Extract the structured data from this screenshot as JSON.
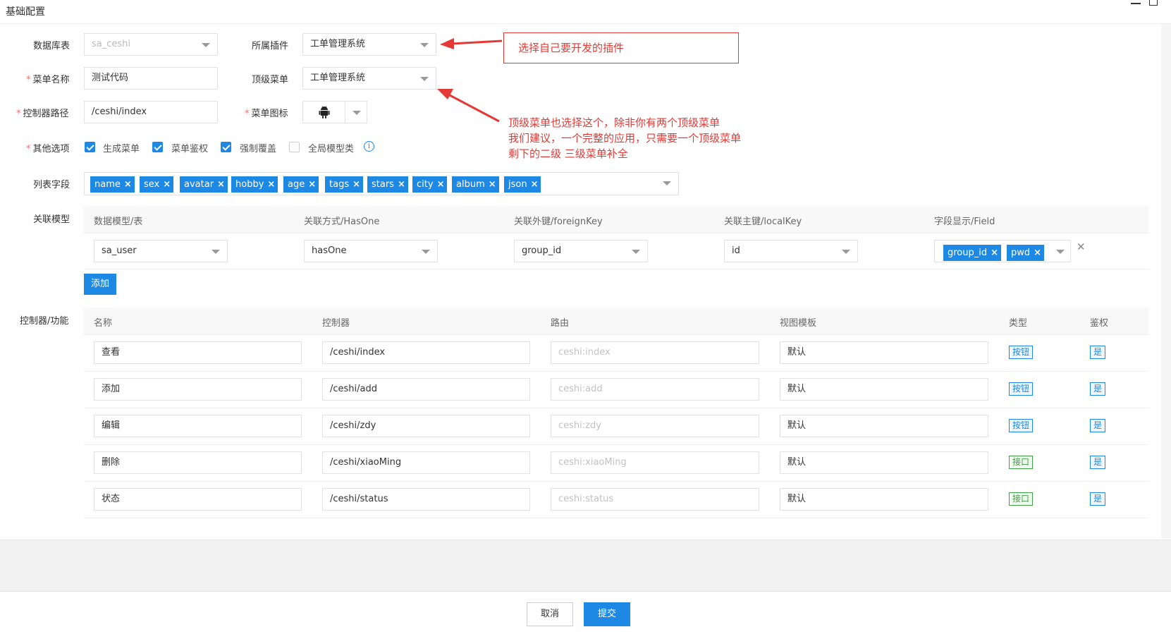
{
  "window": {
    "title": "基础配置"
  },
  "form": {
    "db_table": {
      "label": "数据库表",
      "value": "sa_ceshi"
    },
    "plugin": {
      "label": "所属插件",
      "value": "工单管理系统"
    },
    "menu_name": {
      "label": "菜单名称",
      "value": "测试代码"
    },
    "top_menu": {
      "label": "顶级菜单",
      "value": "工单管理系统"
    },
    "controller_path": {
      "label": "控制器路径",
      "value": "/ceshi/index"
    },
    "menu_icon": {
      "label": "菜单图标",
      "icon": "android-icon"
    },
    "options": {
      "label": "其他选项",
      "items": [
        {
          "label": "生成菜单",
          "checked": true
        },
        {
          "label": "菜单鉴权",
          "checked": true
        },
        {
          "label": "强制覆盖",
          "checked": true
        },
        {
          "label": "全局模型类",
          "checked": false
        }
      ],
      "info_glyph": "i"
    },
    "list_fields": {
      "label": "列表字段",
      "tags": [
        "name",
        "sex",
        "avatar",
        "hobby",
        "age",
        "tags",
        "stars",
        "city",
        "album",
        "json"
      ],
      "remove_glyph": "×"
    },
    "relations": {
      "label": "关联模型",
      "headers": [
        "数据模型/表",
        "关联方式/HasOne",
        "关联外键/foreignKey",
        "关联主键/localKey",
        "字段显示/Field"
      ],
      "row": {
        "model": "sa_user",
        "method": "hasOne",
        "foreign_key": "group_id",
        "local_key": "id",
        "fields": [
          "group_id",
          "pwd"
        ]
      },
      "remove_glyph": "✕",
      "add_label": "添加"
    },
    "functions": {
      "label": "控制器/功能",
      "headers": [
        "名称",
        "控制器",
        "路由",
        "视图模板",
        "类型",
        "鉴权"
      ],
      "rows": [
        {
          "name": "查看",
          "controller": "/ceshi/index",
          "route_placeholder": "ceshi:index",
          "template": "默认",
          "type": "按钮",
          "type_color": "blue",
          "auth": "是"
        },
        {
          "name": "添加",
          "controller": "/ceshi/add",
          "route_placeholder": "ceshi:add",
          "template": "默认",
          "type": "按钮",
          "type_color": "blue",
          "auth": "是"
        },
        {
          "name": "编辑",
          "controller": "/ceshi/zdy",
          "route_placeholder": "ceshi:zdy",
          "template": "默认",
          "type": "按钮",
          "type_color": "blue",
          "auth": "是"
        },
        {
          "name": "删除",
          "controller": "/ceshi/xiaoMing",
          "route_placeholder": "ceshi:xiaoMing",
          "template": "默认",
          "type": "接口",
          "type_color": "green",
          "auth": "是"
        },
        {
          "name": "状态",
          "controller": "/ceshi/status",
          "route_placeholder": "ceshi:status",
          "template": "默认",
          "type": "接口",
          "type_color": "green",
          "auth": "是"
        }
      ]
    }
  },
  "footer": {
    "cancel_label": "取消",
    "submit_label": "提交"
  },
  "annotations": {
    "box_text": "选择自己要开发的插件",
    "lines": [
      "顶级菜单也选择这个，除非你有两个顶级菜单",
      "我们建议，一个完整的应用，只需要一个顶级菜单",
      "剩下的二级 三级菜单补全"
    ]
  },
  "colors": {
    "primary": "#1e88e5",
    "annotation": "#e53935",
    "badge_green": "#43a047"
  }
}
